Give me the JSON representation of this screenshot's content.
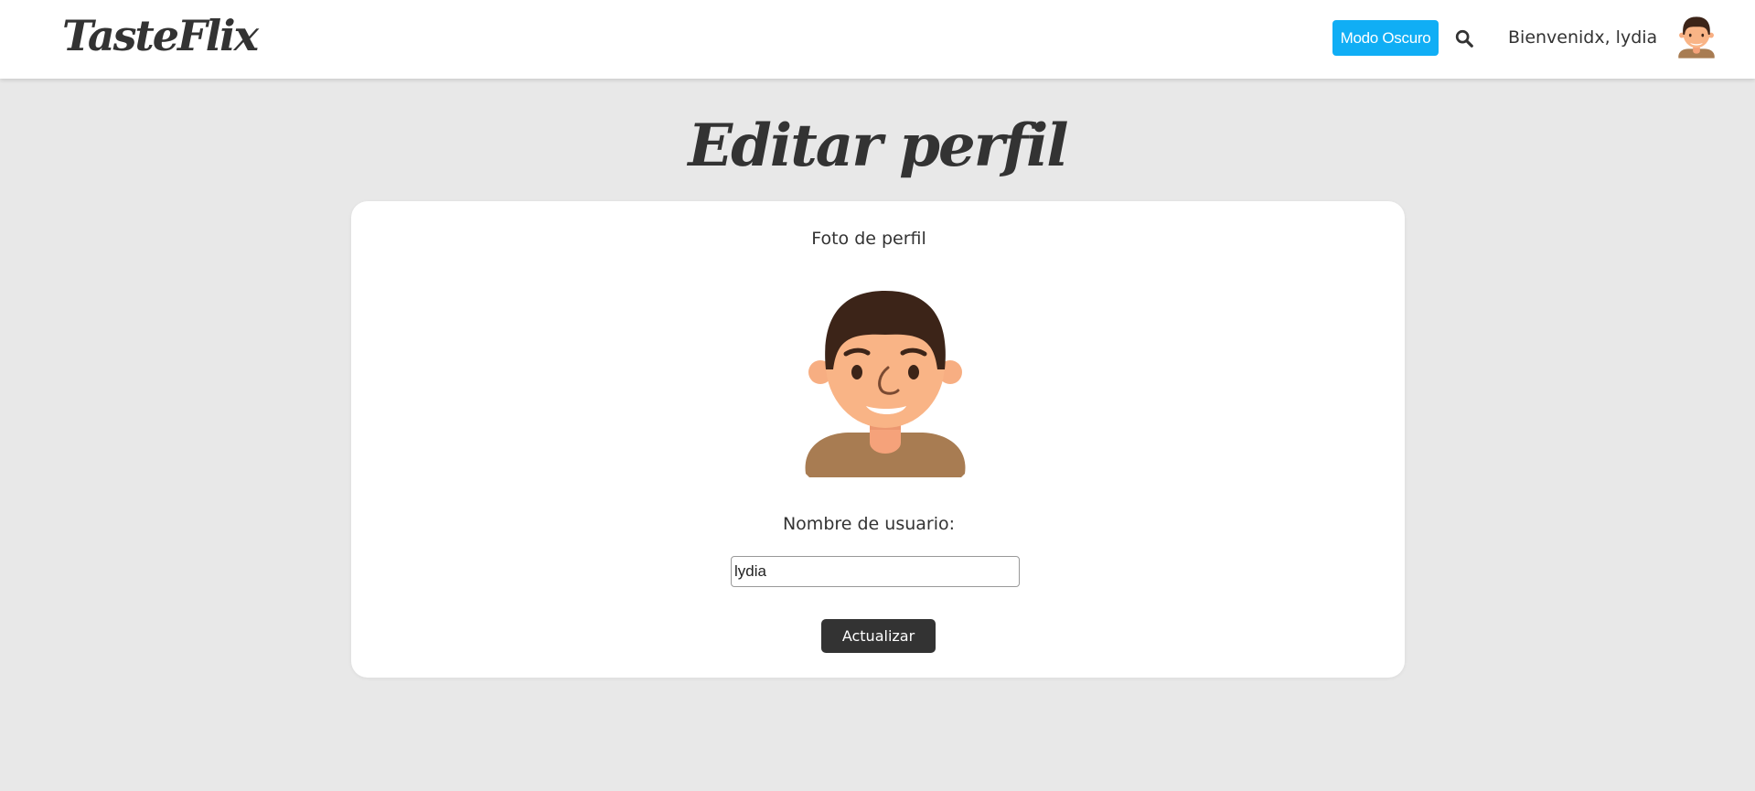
{
  "navbar": {
    "logo": "TasteFlix",
    "dark_mode_label": "Modo Oscuro",
    "welcome_text": "Bienvenidx, lydia",
    "search_icon": "search-icon",
    "avatar_icon": "user-avatar"
  },
  "main": {
    "title": "Editar perfil",
    "photo_label": "Foto de perfil",
    "username_label": "Nombre de usuario:",
    "username_value": "lydia",
    "update_label": "Actualizar"
  },
  "colors": {
    "background": "#e8e8e8",
    "accent": "#10aef5",
    "text": "#333333",
    "button": "#333333"
  }
}
